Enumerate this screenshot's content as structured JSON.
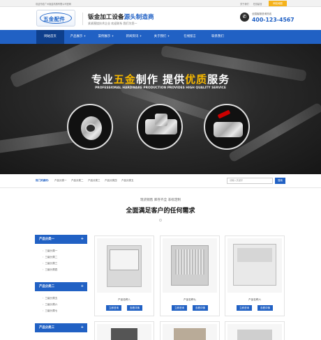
{
  "topbar": {
    "welcome": "欢迎光临广州钣金机械有限公司官网",
    "links": [
      "关于我们",
      "在线留言"
    ],
    "mobile": "网站地图"
  },
  "header": {
    "logo_text": "五金配件",
    "slogan_a": "钣金加工设备",
    "slogan_b": "源头制造商",
    "subslogan": "紧紧围绕技术企业  欢迎联系 我们为您一",
    "hotline_label": "全国客服咨询热线",
    "hotline_number": "400-123-4567"
  },
  "nav": {
    "items": [
      "网站首页",
      "产品展示 +",
      "案例展示 +",
      "新闻资讯 +",
      "关于我们 +",
      "在线留言",
      "联系我们"
    ]
  },
  "banner": {
    "headline_a": "专业",
    "headline_b": "五金",
    "headline_c": "制作   提供",
    "headline_d": "优质",
    "headline_e": "服务",
    "subline": "PROFESSIONAL HARDWARE PRODUCTION PROVIDES HIGH QUALITY SERVICE"
  },
  "hotbar": {
    "label": "热门关键词：",
    "keywords": [
      "产品分类一",
      "产品分类二",
      "产品分类三",
      "产品分类四",
      "产品分类五"
    ],
    "search_placeholder": "请输入关键字",
    "search_button": "搜索"
  },
  "products": {
    "small": "现货销售 库存齐全 非标定制",
    "title": "全面满足客户的任何需求"
  },
  "sidebar": {
    "cat1": {
      "title": "产品分类一",
      "items": [
        "三级分类一",
        "三级分类二",
        "三级分类三",
        "三级分类四"
      ]
    },
    "cat2": {
      "title": "产品分类二",
      "items": [
        "三级分类五",
        "三级分类六",
        "三级分类七"
      ]
    },
    "cat3": {
      "title": "产品分类三"
    }
  },
  "cards": [
    {
      "caption": "产品名称八",
      "btn1": "立即咨询",
      "btn2": "查看详情"
    },
    {
      "caption": "产品名称七",
      "btn1": "立即咨询",
      "btn2": "查看详情"
    },
    {
      "caption": "产品名称六",
      "btn1": "立即咨询",
      "btn2": "查看详情"
    }
  ],
  "colors": {
    "primary": "#2161c4",
    "nav_active": "#0e3f8c",
    "gold": "#f5b700",
    "mobile_btn": "#f5b21b"
  }
}
